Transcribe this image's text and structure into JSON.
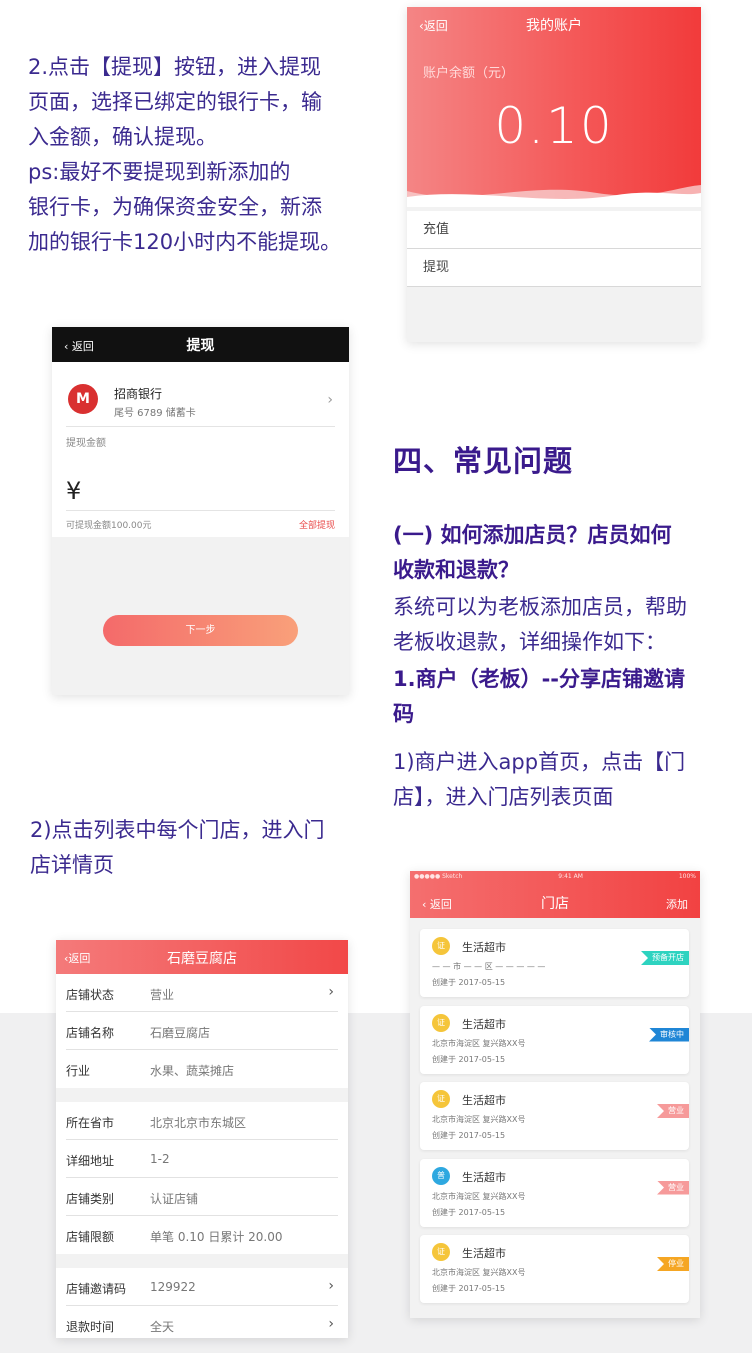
{
  "step2_text": [
    "2.点击【提现】按钮，进入提现",
    "页面，选择已绑定的银行卡，输",
    "入金额，确认提现。",
    "ps:最好不要提现到新添加的",
    "银行卡，为确保资金安全，新添",
    "加的银行卡120小时内不能提现。"
  ],
  "account_screen": {
    "back": "‹返回",
    "title": "我的账户",
    "balance_label": "账户余额（元）",
    "balance": "0.10",
    "rows": [
      "充值",
      "提现"
    ]
  },
  "withdraw_screen": {
    "back": "‹ 返回",
    "title": "提现",
    "bank_logo": "M",
    "bank_name": "招商银行",
    "card_info": "尾号 6789 储蓄卡",
    "amount_label": "提现金额",
    "currency": "¥",
    "available": "可提现金额100.00元",
    "withdraw_all": "全部提现",
    "next_button": "下一步"
  },
  "faq": {
    "section_title": "四、常见问题",
    "question": [
      "(一)    如何添加店员？店员如何",
      "收款和退款？"
    ],
    "answer": [
      "系统可以为老板添加店员，帮助",
      "老板收退款，详细操作如下："
    ],
    "step1": [
      "1.商户（老板）--分享店铺邀请",
      "码"
    ],
    "substep1": [
      "1)商户进入app首页，点击【门",
      "店】，进入门店列表页面"
    ]
  },
  "substep2": [
    "2)点击列表中每个门店，进入门",
    "店详情页"
  ],
  "detail_screen": {
    "back": "‹返回",
    "title": "石磨豆腐店",
    "group1": [
      {
        "key": "店铺状态",
        "value": "营业",
        "chevron": true
      },
      {
        "key": "店铺名称",
        "value": "石磨豆腐店",
        "chevron": false
      },
      {
        "key": "行业",
        "value": "水果、蔬菜摊店",
        "chevron": false
      }
    ],
    "group2": [
      {
        "key": "所在省市",
        "value": "北京北京市东城区",
        "chevron": false
      },
      {
        "key": "详细地址",
        "value": "1-2",
        "chevron": false
      },
      {
        "key": "店铺类别",
        "value": "认证店铺",
        "chevron": false
      },
      {
        "key": "店铺限额",
        "value": "单笔 0.10 日累计 20.00",
        "chevron": false
      }
    ],
    "group3": [
      {
        "key": "店铺邀请码",
        "value": "129922",
        "chevron": true
      },
      {
        "key": "退款时间",
        "value": "全天",
        "chevron": true
      }
    ]
  },
  "list_screen": {
    "status_left": "●●●●● Sketch",
    "status_time": "9:41 AM",
    "status_right": "100%",
    "back": "‹ 返回",
    "title": "门店",
    "add": "添加",
    "stores": [
      {
        "badge": "证",
        "badge_color": "#f5c53a",
        "name": "生活超市",
        "address": "— — 市  — — 区    — — — — —",
        "date": "创建于  2017-05-15",
        "tag": "预备开店",
        "tag_color": "#2ed3c0"
      },
      {
        "badge": "证",
        "badge_color": "#f5c53a",
        "name": "生活超市",
        "address": "北京市海淀区    复兴路XX号",
        "date": "创建于  2017-05-15",
        "tag": "审核中",
        "tag_color": "#1f86d6"
      },
      {
        "badge": "证",
        "badge_color": "#f5c53a",
        "name": "生活超市",
        "address": "北京市海淀区    复兴路XX号",
        "date": "创建于  2017-05-15",
        "tag": "营业",
        "tag_color": "#f69a9a"
      },
      {
        "badge": "普",
        "badge_color": "#2ea8e0",
        "name": "生活超市",
        "address": "北京市海淀区    复兴路XX号",
        "date": "创建于  2017-05-15",
        "tag": "营业",
        "tag_color": "#f69a9a"
      },
      {
        "badge": "证",
        "badge_color": "#f5c53a",
        "name": "生活超市",
        "address": "北京市海淀区    复兴路XX号",
        "date": "创建于  2017-05-15",
        "tag": "停业",
        "tag_color": "#f5a623"
      }
    ]
  }
}
